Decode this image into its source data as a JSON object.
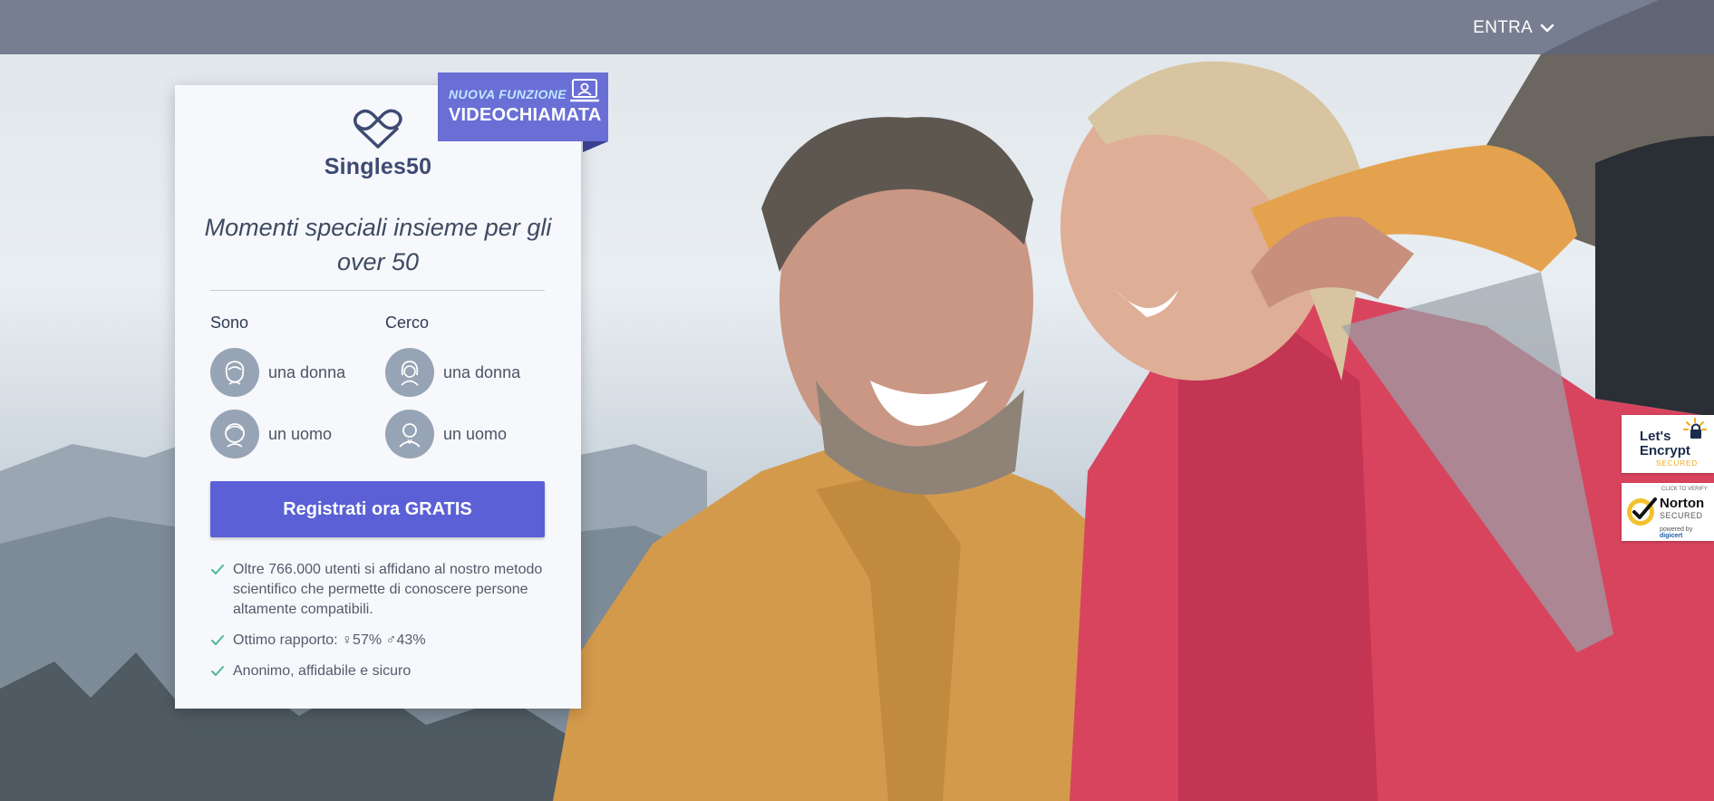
{
  "header": {
    "login_label": "ENTRA"
  },
  "brand": {
    "name": "Singles50"
  },
  "ribbon": {
    "top_text": "NUOVA FUNZIONE",
    "bottom_text": "VIDEOCHIAMATA"
  },
  "tagline": "Momenti speciali insieme per gli over 50",
  "form": {
    "sono_title": "Sono",
    "cerco_title": "Cerco",
    "sono_options": [
      "una donna",
      "un uomo"
    ],
    "cerco_options": [
      "una donna",
      "un uomo"
    ],
    "cta_label": "Registrati ora GRATIS"
  },
  "features": [
    "Oltre 766.000 utenti si affidano al nostro metodo scientifico che permette di conoscere persone altamente compatibili.",
    "Ottimo rapporto: ♀57% ♂43%",
    "Anonimo, affidabile e sicuro"
  ],
  "badges": {
    "letsencrypt": {
      "line1": "Let's",
      "line2": "Encrypt",
      "line3": "SECURED"
    },
    "norton": {
      "tiny": "CLICK TO VERIFY",
      "line1": "Norton",
      "line2": "SECURED",
      "powered": "powered by",
      "brand": "digicert"
    }
  },
  "colors": {
    "primary": "#5b60d6",
    "ribbon": "#6a6fd6",
    "brand_text": "#3d4a73",
    "check": "#4fb596"
  },
  "icons": {
    "login_chevron": "chevron-down-icon",
    "logo": "heart-infinity-icon",
    "ribbon": "video-call-icon",
    "avatars": [
      "woman-avatar-icon",
      "man-avatar-icon"
    ],
    "check": "check-icon"
  }
}
